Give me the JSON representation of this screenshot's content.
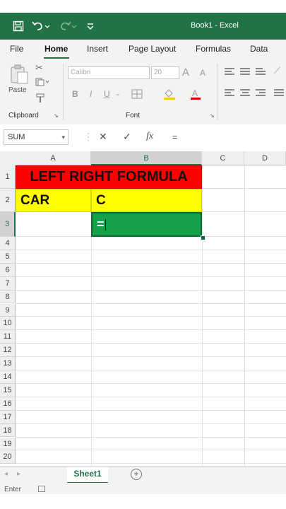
{
  "titlebar": {
    "title": "Book1  -  Excel",
    "icons": [
      "save-icon",
      "undo-icon",
      "redo-icon",
      "customize-qat-icon"
    ]
  },
  "ribbon_tabs": [
    "File",
    "Home",
    "Insert",
    "Page Layout",
    "Formulas",
    "Data"
  ],
  "ribbon": {
    "paste_label": "Paste",
    "clipboard_label": "Clipboard",
    "font_name": "Calibri",
    "font_size": "20",
    "font_label": "Font",
    "bold": "B",
    "italic": "I",
    "underline": "U",
    "grow_font": "A",
    "shrink_font": "A"
  },
  "formula_bar": {
    "name_box": "SUM",
    "cancel": "✕",
    "enter": "✓",
    "fx": "fx",
    "content": "="
  },
  "columns": [
    "A",
    "B",
    "C",
    "D"
  ],
  "rows": [
    "1",
    "2",
    "3",
    "4",
    "5",
    "6",
    "7",
    "8",
    "9",
    "10",
    "11",
    "12",
    "13",
    "14",
    "15",
    "16",
    "17",
    "18",
    "19",
    "20"
  ],
  "cells": {
    "A1": "LEFT RIGHT FORMULA",
    "A2": "CAR",
    "B2": "C",
    "B3": "="
  },
  "colors": {
    "excel_green": "#217346",
    "title_fill": "#ff0000",
    "input_fill": "#ffff00",
    "active_fill": "#16a04a"
  },
  "sheets": [
    "Sheet1"
  ],
  "status": "Enter"
}
